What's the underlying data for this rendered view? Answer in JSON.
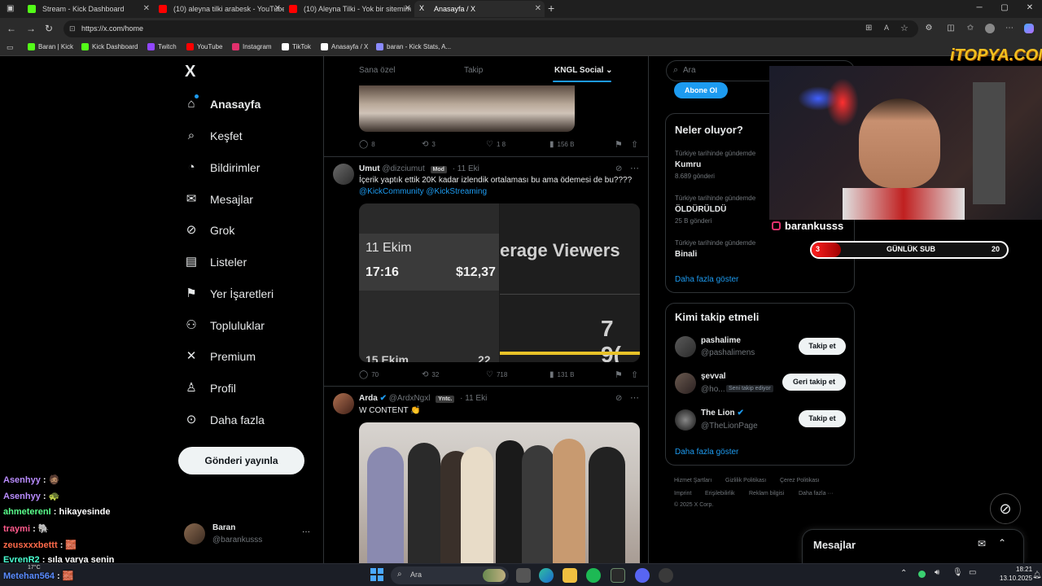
{
  "browser": {
    "tabs": [
      {
        "title": "Stream - Kick Dashboard",
        "icon": "kick-icon",
        "color": "#53fc18"
      },
      {
        "title": "(10) aleyna tilki arabesk - YouTube",
        "icon": "youtube-icon",
        "color": "#ff0000"
      },
      {
        "title": "(10) Aleyna Tilki - Yok bir sitemim",
        "icon": "youtube-icon",
        "color": "#ff0000"
      },
      {
        "title": "Anasayfa / X",
        "icon": "x-icon",
        "color": "#ffffff"
      }
    ],
    "new_tab_label": "+",
    "url": "https://x.com/home",
    "bookmarks": [
      {
        "label": "Baran | Kick",
        "color": "#53fc18"
      },
      {
        "label": "Kick Dashboard",
        "color": "#53fc18"
      },
      {
        "label": "Twitch",
        "color": "#9146ff"
      },
      {
        "label": "YouTube",
        "color": "#ff0000"
      },
      {
        "label": "Instagram",
        "color": "#e1306c"
      },
      {
        "label": "TikTok",
        "color": "#ffffff"
      },
      {
        "label": "Anasayfa / X",
        "color": "#ffffff"
      },
      {
        "label": "baran - Kick Stats, A...",
        "color": "#8a8aff"
      }
    ]
  },
  "sidebar": {
    "logo": "X",
    "items": [
      {
        "label": "Anasayfa",
        "icon": "home-icon",
        "glyph": "⌂"
      },
      {
        "label": "Keşfet",
        "icon": "search-icon",
        "glyph": "⌕"
      },
      {
        "label": "Bildirimler",
        "icon": "bell-icon",
        "glyph": "◔"
      },
      {
        "label": "Mesajlar",
        "icon": "mail-icon",
        "glyph": "✉"
      },
      {
        "label": "Grok",
        "icon": "grok-icon",
        "glyph": "⊘"
      },
      {
        "label": "Listeler",
        "icon": "list-icon",
        "glyph": "▤"
      },
      {
        "label": "Yer İşaretleri",
        "icon": "bookmark-icon",
        "glyph": "⚑"
      },
      {
        "label": "Topluluklar",
        "icon": "communities-icon",
        "glyph": "⚇"
      },
      {
        "label": "Premium",
        "icon": "x-premium-icon",
        "glyph": "✕"
      },
      {
        "label": "Profil",
        "icon": "profile-icon",
        "glyph": "♙"
      },
      {
        "label": "Daha fazla",
        "icon": "more-icon",
        "glyph": "⊙"
      }
    ],
    "post_button": "Gönderi yayınla",
    "account": {
      "name": "Baran",
      "handle": "@barankusss",
      "more": "···"
    }
  },
  "timeline": {
    "tabs": [
      "Sana özel",
      "Takip",
      "KNGL Social"
    ],
    "tweet0_actions": {
      "replies": "8",
      "retweets": "3",
      "likes": "1 8",
      "views": "156 B"
    },
    "tweet1": {
      "name": "Umut",
      "handle": "@dizciumut",
      "badge": "Mod",
      "date": "· 11 Eki",
      "text": "İçerik yaptık ettik 20K kadar izlendik ortalaması bu ama ödemesi de bu????",
      "mentions": "@KickCommunity @KickStreaming",
      "image_date": "11 Ekim",
      "image_time": "17:16",
      "image_money": "$12,37",
      "image_label": "erage Viewers",
      "image_value": "7 9(",
      "image_row2": "15 Ekim",
      "image_row2_val": "22",
      "actions": {
        "replies": "70",
        "retweets": "32",
        "likes": "718",
        "views": "131 B"
      }
    },
    "tweet2": {
      "name": "Arda",
      "handle": "@ArdxNgxl",
      "badge": "Yntc.",
      "date": "· 11 Eki",
      "text": "W CONTENT 👏"
    }
  },
  "right": {
    "search_placeholder": "Ara",
    "subscribe_label": "Abone Ol",
    "trends_title": "Neler oluyor?",
    "trends": [
      {
        "context": "Türkiye tarihinde gündemde",
        "name": "Kumru",
        "count": "8.689 gönderi"
      },
      {
        "context": "Türkiye tarihinde gündemde",
        "name": "ÖLDÜRÜLDÜ",
        "count": "25 B gönderi"
      },
      {
        "context": "Türkiye tarihinde gündemde",
        "name": "Binali",
        "count": ""
      }
    ],
    "trends_more": "Daha fazla göster",
    "who_title": "Kimi takip etmeli",
    "who": [
      {
        "name": "pashalime",
        "handle": "@pashalimens",
        "button": "Takip et",
        "note": ""
      },
      {
        "name": "şevval",
        "handle": "@ho...",
        "button": "Geri takip et",
        "note": "Seni takip ediyor"
      },
      {
        "name": "The Lion",
        "handle": "@TheLionPage",
        "button": "Takip et",
        "note": ""
      }
    ],
    "who_more": "Daha fazla göster",
    "footer": [
      "Hizmet Şartları",
      "Gizlilik Politikası",
      "Çerez Politikası",
      "Imprint",
      "Erişilebilirlik",
      "Reklam bilgisi",
      "Daha fazla ···",
      "© 2025 X Corp."
    ],
    "messages_label": "Mesajlar"
  },
  "overlay": {
    "watermark": "iTOPYA.COM",
    "instagram": "barankusss",
    "sub_goal": {
      "label": "GÜNLÜK SUB",
      "current": "3",
      "target": "20",
      "fraction": 0.15
    },
    "chat": [
      {
        "user": "Asenhyy",
        "msg": ": 🧔🏽",
        "color": "#b98cff"
      },
      {
        "user": "Asenhyy",
        "msg": ": 🐢",
        "color": "#b98cff"
      },
      {
        "user": "ahmeterenI",
        "msg": ": hikayesinde",
        "color": "#5aff8c"
      },
      {
        "user": "traymi",
        "msg": ": 🐘",
        "color": "#ff5a8c"
      },
      {
        "user": "zeusxxxbettt",
        "msg": ": 🧱",
        "color": "#ff6a4a"
      },
      {
        "user": "EvrenR2",
        "msg": ": sıla varya senin",
        "color": "#4affd2"
      },
      {
        "user": "Metehan564",
        "msg": ": 🧱",
        "color": "#5a8cff"
      }
    ]
  },
  "taskbar": {
    "weather": "17°C",
    "search": "Ara",
    "time": "18:21",
    "date": "13.10.2025"
  }
}
